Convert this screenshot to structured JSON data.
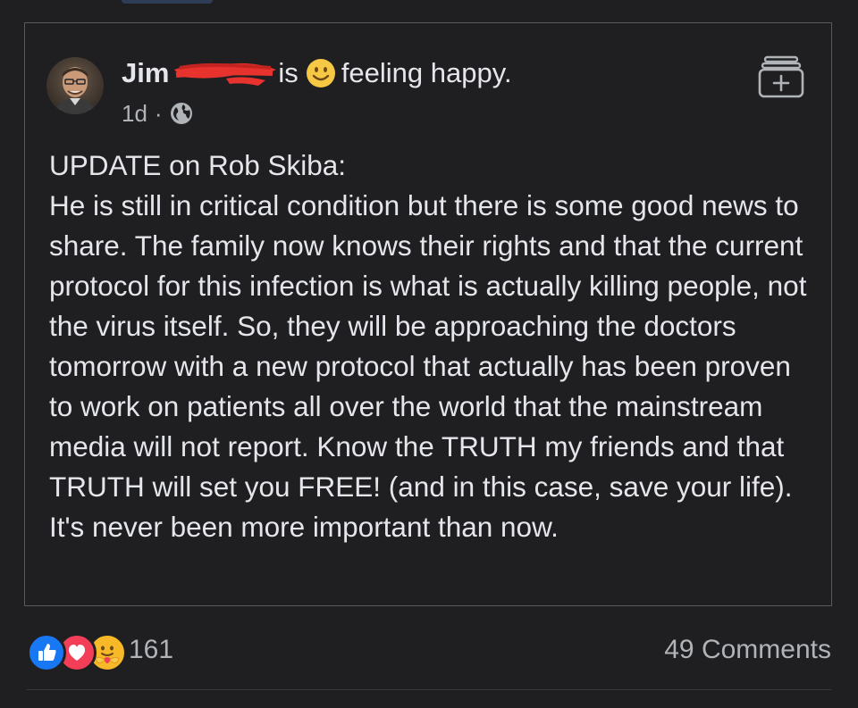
{
  "post": {
    "author": {
      "name": "Jim",
      "name_redacted": true
    },
    "header": {
      "verb": "is",
      "activity": "feeling happy.",
      "activity_icon": "smile-icon"
    },
    "meta": {
      "time": "1d",
      "separator": "·",
      "privacy_icon": "globe-icon"
    },
    "save_icon": "save-to-collection-icon",
    "body_lines": [
      "UPDATE on Rob Skiba:",
      "He is still in critical condition but there is some good news to share. The family now knows their rights and that the current protocol for this infection is what is actually killing people, not the virus itself. So, they will be approaching the doctors tomorrow with a new protocol that actually has been proven to work on patients all over the world that the mainstream media will not report. Know the TRUTH my friends and that TRUTH will set you FREE! (and in this case, save your life). It's never been more important than now."
    ]
  },
  "footer": {
    "reaction_icons": [
      "like-icon",
      "love-icon",
      "care-icon"
    ],
    "reaction_count": "161",
    "comments_label": "49 Comments"
  },
  "colors": {
    "background": "#1f1f21",
    "text": "#e4e6eb",
    "secondary_text": "#b0b3b8",
    "like_blue": "#1877f2",
    "love_red": "#f33e58",
    "care_yellow": "#f7b928",
    "redaction_red": "#e8322e"
  }
}
